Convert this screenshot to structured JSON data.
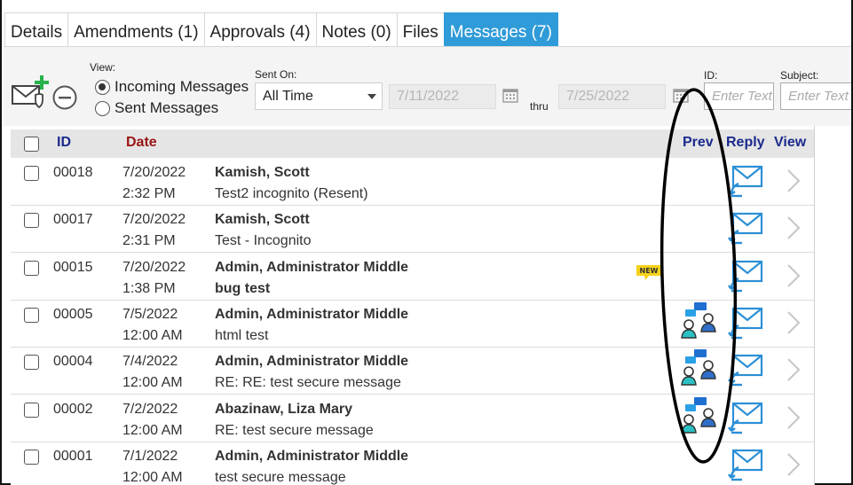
{
  "tabs": [
    {
      "label": "Details",
      "active": false
    },
    {
      "label": "Amendments (1)",
      "active": false
    },
    {
      "label": "Approvals (4)",
      "active": false
    },
    {
      "label": "Notes (0)",
      "active": false
    },
    {
      "label": "Files",
      "active": false
    },
    {
      "label": "Messages (7)",
      "active": true
    }
  ],
  "toolbar": {
    "view_label": "View:",
    "incoming_label": "Incoming Messages",
    "sent_label": "Sent Messages",
    "sent_on_label": "Sent On:",
    "sent_on_value": "All Time",
    "date_from": "7/11/2022",
    "thru_label": "thru",
    "date_to": "7/25/2022",
    "id_label": "ID:",
    "id_placeholder": "Enter Text",
    "subject_label": "Subject:",
    "subject_placeholder": "Enter Text"
  },
  "table": {
    "headers": {
      "id": "ID",
      "date": "Date",
      "prev": "Prev",
      "reply": "Reply",
      "view": "View"
    },
    "rows": [
      {
        "id": "00018",
        "date": "7/20/2022",
        "time": "2:32 PM",
        "from": "Kamish, Scott",
        "subject": "Test2 incognito (Resent)",
        "subject_bold": false,
        "prev_icon": "",
        "new_badge": ""
      },
      {
        "id": "00017",
        "date": "7/20/2022",
        "time": "2:31 PM",
        "from": "Kamish, Scott",
        "subject": "Test - Incognito",
        "subject_bold": false,
        "prev_icon": "",
        "new_badge": ""
      },
      {
        "id": "00015",
        "date": "7/20/2022",
        "time": "1:38 PM",
        "from": "Admin, Administrator Middle",
        "subject": "bug test",
        "subject_bold": true,
        "prev_icon": "",
        "new_badge": "NEW"
      },
      {
        "id": "00005",
        "date": "7/5/2022",
        "time": "12:00 AM",
        "from": "Admin, Administrator Middle",
        "subject": "html test",
        "subject_bold": false,
        "prev_icon": "conversation-icon",
        "new_badge": ""
      },
      {
        "id": "00004",
        "date": "7/4/2022",
        "time": "12:00 AM",
        "from": "Admin, Administrator Middle",
        "subject": "RE: RE: test secure message",
        "subject_bold": false,
        "prev_icon": "conversation-icon",
        "new_badge": ""
      },
      {
        "id": "00002",
        "date": "7/2/2022",
        "time": "12:00 AM",
        "from": "Abazinaw, Liza Mary",
        "subject": "RE: test secure message",
        "subject_bold": false,
        "prev_icon": "conversation-icon",
        "new_badge": ""
      },
      {
        "id": "00001",
        "date": "7/1/2022",
        "time": "12:00 AM",
        "from": "Admin, Administrator Middle",
        "subject": "test secure message",
        "subject_bold": false,
        "prev_icon": "",
        "new_badge": ""
      }
    ]
  },
  "icons": {
    "reply": "reply-mail-icon",
    "view": "chevron-right-icon",
    "compose": "compose-message-icon",
    "remove": "remove-circle-icon",
    "calendar": "calendar-icon"
  },
  "colors": {
    "accent": "#2f9bd8",
    "id_header": "#1b2a8c",
    "date_header": "#9a1414",
    "prev_header": "#1b2a8c",
    "mail_icon": "#2b8fd6",
    "compose_plus": "#27b24a",
    "new_badge": "#f6d21b"
  }
}
